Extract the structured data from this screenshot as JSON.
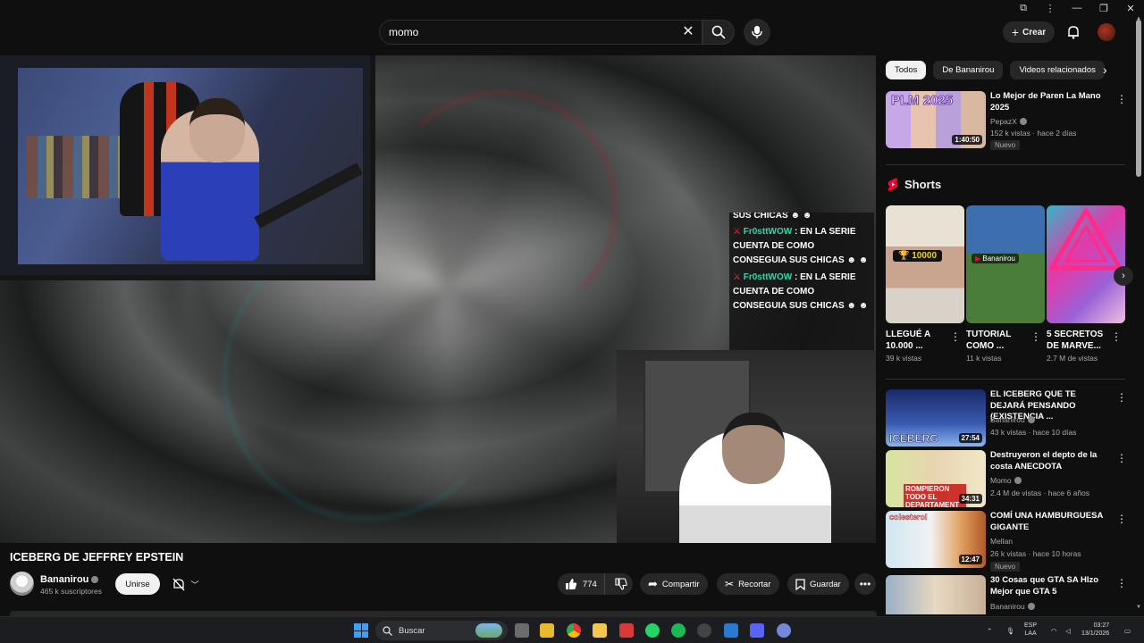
{
  "search": {
    "query": "momo"
  },
  "header": {
    "create_label": "Crear"
  },
  "player": {
    "chat": [
      {
        "user": "",
        "text": "SUS CHICAS"
      },
      {
        "user": "Fr0sttWOW",
        "text": ": EN LA SERIE CUENTA DE COMO CONSEGUIA SUS CHICAS"
      },
      {
        "user": "Fr0sttWOW",
        "text": ": EN LA SERIE CUENTA DE COMO CONSEGUIA SUS CHICAS"
      }
    ]
  },
  "video": {
    "title": "ICEBERG DE JEFFREY EPSTEIN",
    "channel": "Bananirou",
    "subscribers": "465 k suscriptores",
    "join_label": "Unirse",
    "likes": "774",
    "share_label": "Compartir",
    "clip_label": "Recortar",
    "save_label": "Guardar"
  },
  "sidebar": {
    "chips": [
      "Todos",
      "De Bananirou",
      "Videos relacionados"
    ],
    "recs_top": [
      {
        "title": "Lo Mejor de Paren La Mano 2025",
        "channel": "PepazX",
        "meta": "152 k vistas · hace 2 días",
        "duration": "1:40:50",
        "badge": "Nuevo",
        "thumb_text": "PLM 2025"
      }
    ],
    "shorts_title": "Shorts",
    "shorts": [
      {
        "title": "LLEGUÉ A 10.000 ...",
        "views": "39 k vistas",
        "overlay": "10000"
      },
      {
        "title": "TUTORIAL COMO ...",
        "views": "11 k vistas",
        "overlay": "Bananirou"
      },
      {
        "title": "5 SECRETOS DE MARVE...",
        "views": "2.7 M de vistas",
        "overlay": ""
      }
    ],
    "recs": [
      {
        "title": "EL ICEBERG QUE TE DEJARÁ PENSANDO (EXISTENCIA ...",
        "channel": "Bananirou",
        "meta": "43 k vistas · hace 10 días",
        "duration": "27:54",
        "badge": "",
        "thumb_text": "ICEBERG"
      },
      {
        "title": "Destruyeron el depto de la costa ANECDOTA",
        "channel": "Momo",
        "meta": "2.4 M de vistas · hace 6 años",
        "duration": "34:31",
        "badge": "",
        "thumb_text": "ROMPIERON TODO EL DEPARTAMENT"
      },
      {
        "title": "COMÍ UNA HAMBURGUESA GIGANTE",
        "channel": "Mellan",
        "meta": "26 k vistas · hace 10 horas",
        "duration": "12:47",
        "badge": "Nuevo",
        "thumb_text": "colesterol"
      },
      {
        "title": "30 Cosas que GTA SA HIzo Mejor que GTA 5",
        "channel": "Bananirou",
        "meta": "",
        "duration": "",
        "badge": "",
        "thumb_text": ""
      }
    ]
  },
  "taskbar": {
    "search_label": "Buscar",
    "lang_top": "ESP",
    "lang_bottom": "LAA",
    "time": "03:27",
    "date": "13/1/2026"
  },
  "colors": {
    "accent_red": "#ff0033",
    "chat_user": "#33d6a6",
    "taskbar": "#1c1d20"
  }
}
